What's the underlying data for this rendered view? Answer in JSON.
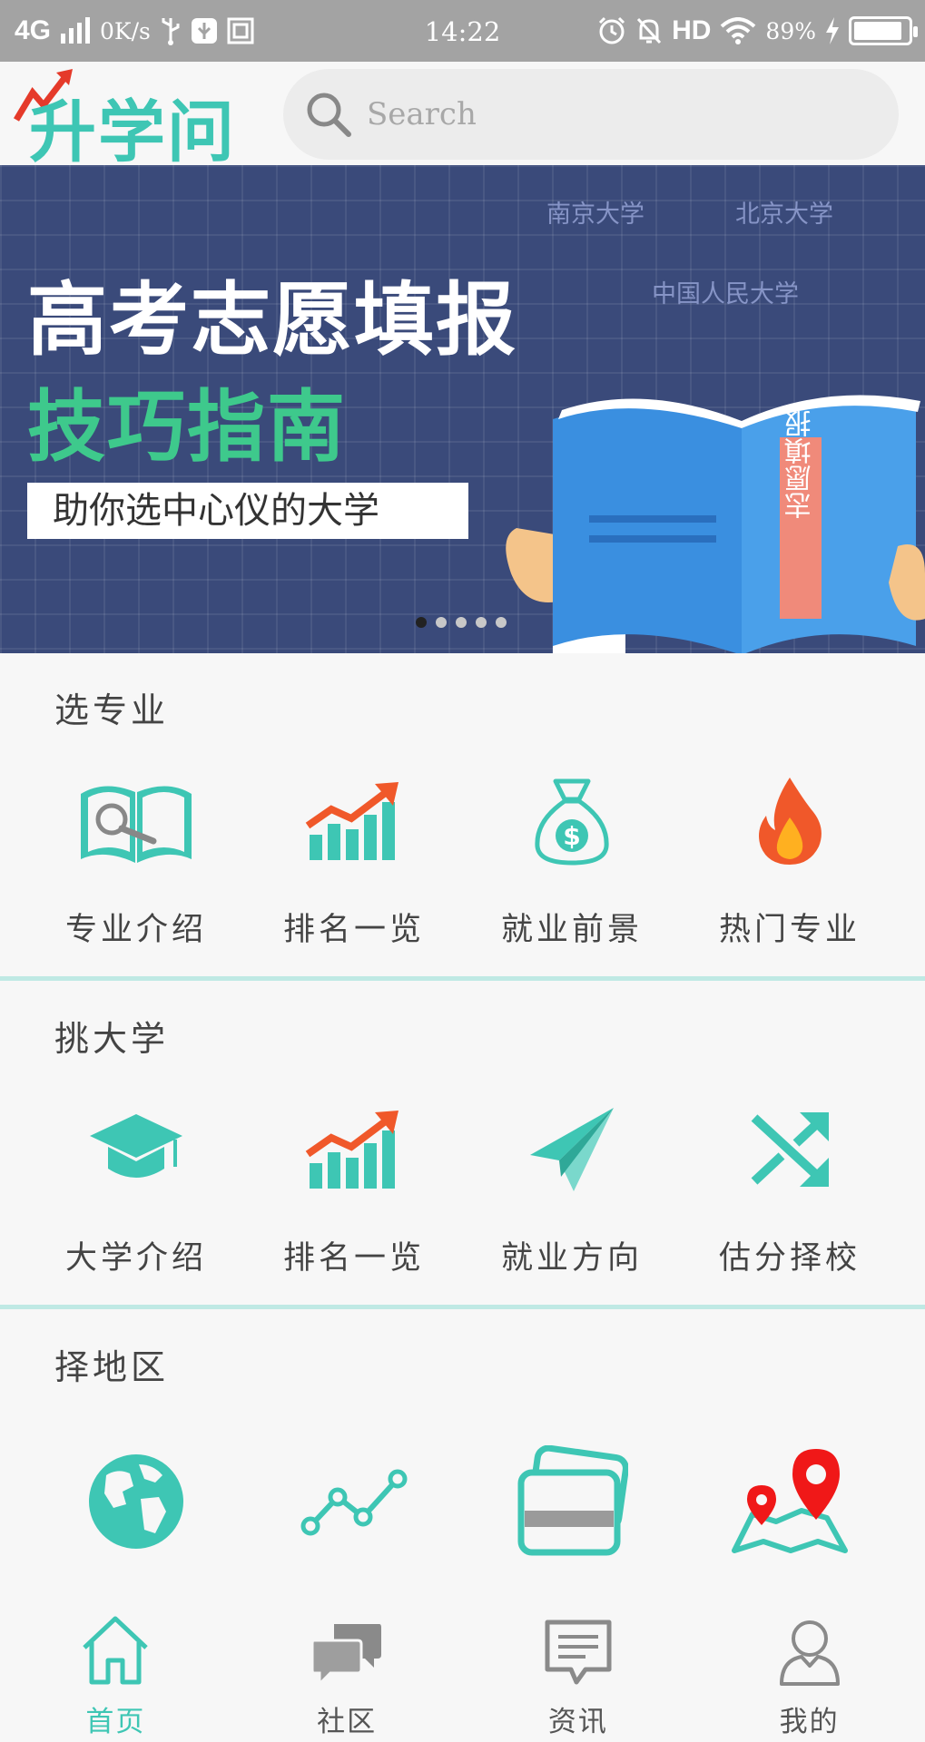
{
  "statusbar": {
    "network": "4G",
    "speed": "0K/s",
    "time": "14:22",
    "hd": "HD",
    "battery": "89%",
    "battery_level": 0.89
  },
  "header": {
    "logo_text": "升学问",
    "search_placeholder": "Search"
  },
  "banner": {
    "universities": [
      "南京大学",
      "北京大学",
      "中国人民大学"
    ],
    "title_line1": "高考志愿填报",
    "title_line2": "技巧指南",
    "subtitle": "助你选中心仪的大学",
    "book_text": "志愿填报",
    "page_count": 5,
    "active_page": 1
  },
  "sections": [
    {
      "title": "选专业",
      "items": [
        {
          "label": "专业介绍",
          "icon": "book-search-icon"
        },
        {
          "label": "排名一览",
          "icon": "trend-bars-icon"
        },
        {
          "label": "就业前景",
          "icon": "money-bag-icon"
        },
        {
          "label": "热门专业",
          "icon": "fire-icon"
        }
      ]
    },
    {
      "title": "挑大学",
      "items": [
        {
          "label": "大学介绍",
          "icon": "graduation-cap-icon"
        },
        {
          "label": "排名一览",
          "icon": "trend-bars-icon"
        },
        {
          "label": "就业方向",
          "icon": "paper-plane-icon"
        },
        {
          "label": "估分择校",
          "icon": "shuffle-icon"
        }
      ]
    },
    {
      "title": "择地区",
      "items": [
        {
          "label": "",
          "icon": "globe-icon"
        },
        {
          "label": "",
          "icon": "line-chart-icon"
        },
        {
          "label": "",
          "icon": "cards-icon"
        },
        {
          "label": "",
          "icon": "map-pin-icon"
        }
      ]
    }
  ],
  "nav": [
    {
      "label": "首页",
      "icon": "home-icon",
      "active": true
    },
    {
      "label": "社区",
      "icon": "chat-bubbles-icon",
      "active": false
    },
    {
      "label": "资讯",
      "icon": "message-icon",
      "active": false
    },
    {
      "label": "我的",
      "icon": "person-icon",
      "active": false
    }
  ],
  "colors": {
    "accent": "#3ec6b4",
    "accent_light": "#bfe9e4",
    "orange": "#f0582a",
    "red": "#e52a2a",
    "statusbar": "#a3a3a3",
    "banner_bg": "#3a4a7a"
  }
}
